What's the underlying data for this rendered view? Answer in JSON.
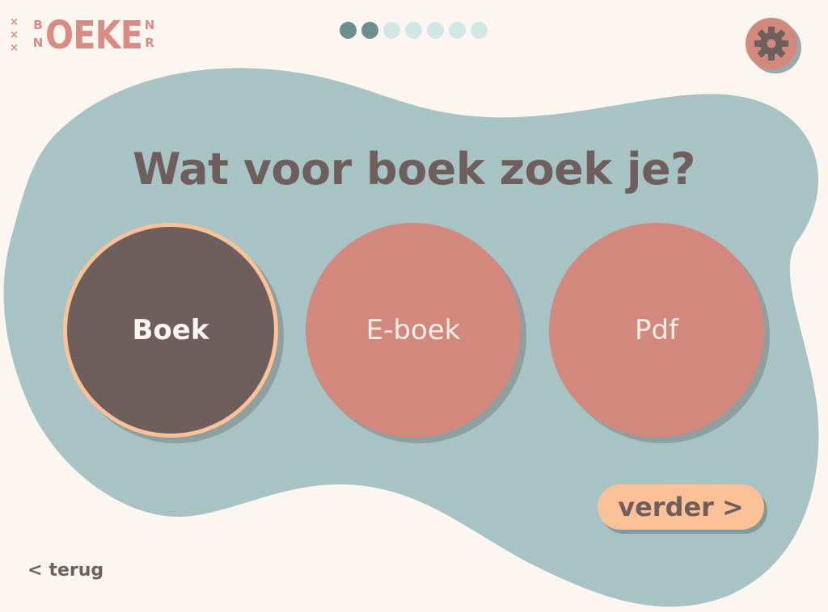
{
  "logo": {
    "crosses": [
      "×",
      "×",
      "×"
    ],
    "small_left": [
      "B",
      "N"
    ],
    "main": "OEKE",
    "small_right": [
      "N",
      "R"
    ]
  },
  "progress": {
    "total_steps": 7,
    "completed_steps": 2
  },
  "settings": {
    "icon": "gear-icon"
  },
  "question": {
    "title": "Wat voor boek zoek je?"
  },
  "choices": [
    {
      "label": "Boek",
      "selected": true
    },
    {
      "label": "E-boek",
      "selected": false
    },
    {
      "label": "Pdf",
      "selected": false
    }
  ],
  "next": {
    "label": "verder",
    "icon": "chevron-right-icon",
    "glyph": ">"
  },
  "back": {
    "label": "terug",
    "icon": "chevron-left-icon",
    "glyph": "<"
  },
  "colors": {
    "background": "#fdf6f0",
    "blob": "#a8c3c4",
    "accent": "#d3887d",
    "selected": "#6e5e5c",
    "highlight": "#fcc197",
    "text": "#6e5e5c",
    "progress_done": "#6e8f8f",
    "progress_todo": "#d2e6e6"
  }
}
